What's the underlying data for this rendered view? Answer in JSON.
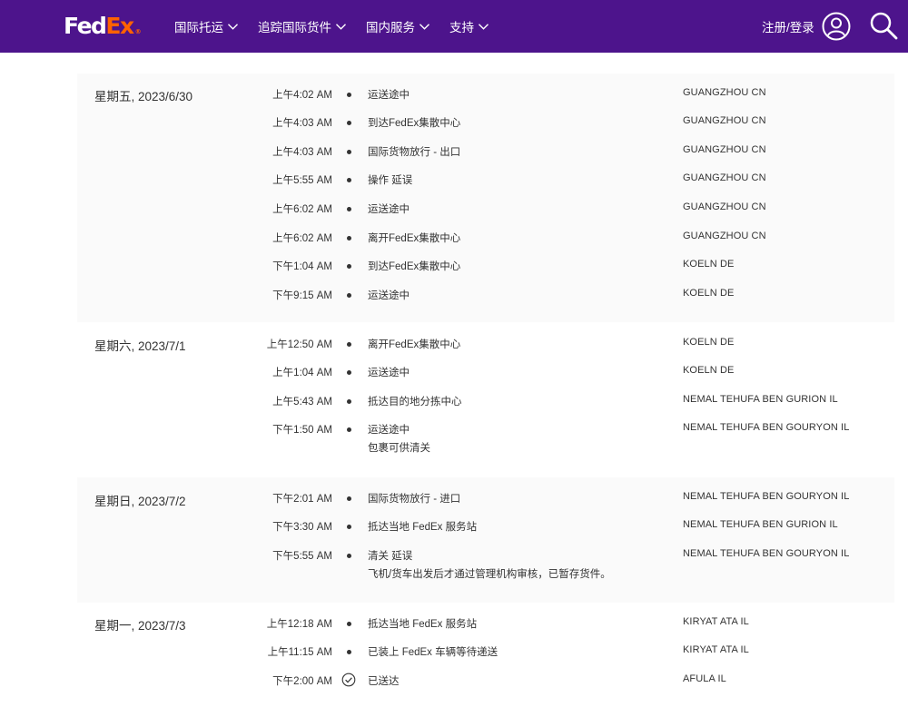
{
  "header": {
    "logo_fed": "Fed",
    "logo_ex": "Ex",
    "logo_reg": "®",
    "nav": [
      "国际托运",
      "追踪国际货件",
      "国内服务",
      "支持"
    ],
    "login_label": "注册/登录",
    "icons": [
      "chevron-down-icon",
      "user-icon",
      "search-icon"
    ],
    "colors": {
      "brand_purple": "#4d148c",
      "brand_orange": "#ff6200"
    }
  },
  "days": [
    {
      "date": "星期五, 2023/6/30",
      "events": [
        {
          "time": "上午4:02 AM",
          "desc": "运送途中",
          "sub": "",
          "loc": "GUANGZHOU CN",
          "icon": "bullet"
        },
        {
          "time": "上午4:03 AM",
          "desc": "到达FedEx集散中心",
          "sub": "",
          "loc": "GUANGZHOU CN",
          "icon": "bullet"
        },
        {
          "time": "上午4:03 AM",
          "desc": "国际货物放行 - 出口",
          "sub": "",
          "loc": "GUANGZHOU CN",
          "icon": "bullet"
        },
        {
          "time": "上午5:55 AM",
          "desc": "操作 延误",
          "sub": "",
          "loc": "GUANGZHOU CN",
          "icon": "bullet"
        },
        {
          "time": "上午6:02 AM",
          "desc": "运送途中",
          "sub": "",
          "loc": "GUANGZHOU CN",
          "icon": "bullet"
        },
        {
          "time": "上午6:02 AM",
          "desc": "离开FedEx集散中心",
          "sub": "",
          "loc": "GUANGZHOU CN",
          "icon": "bullet"
        },
        {
          "time": "下午1:04 AM",
          "desc": "到达FedEx集散中心",
          "sub": "",
          "loc": "KOELN DE",
          "icon": "bullet"
        },
        {
          "time": "下午9:15 AM",
          "desc": "运送途中",
          "sub": "",
          "loc": "KOELN DE",
          "icon": "bullet"
        }
      ]
    },
    {
      "date": "星期六, 2023/7/1",
      "events": [
        {
          "time": "上午12:50 AM",
          "desc": "离开FedEx集散中心",
          "sub": "",
          "loc": "KOELN DE",
          "icon": "bullet"
        },
        {
          "time": "上午1:04 AM",
          "desc": "运送途中",
          "sub": "",
          "loc": "KOELN DE",
          "icon": "bullet"
        },
        {
          "time": "上午5:43 AM",
          "desc": "抵达目的地分拣中心",
          "sub": "",
          "loc": "NEMAL TEHUFA BEN GURION IL",
          "icon": "bullet"
        },
        {
          "time": "下午1:50 AM",
          "desc": "运送途中",
          "sub": "包裹可供清关",
          "loc": "NEMAL TEHUFA BEN GOURYON IL",
          "icon": "bullet"
        }
      ]
    },
    {
      "date": "星期日, 2023/7/2",
      "events": [
        {
          "time": "下午2:01 AM",
          "desc": "国际货物放行 - 进口",
          "sub": "",
          "loc": "NEMAL TEHUFA BEN GOURYON IL",
          "icon": "bullet"
        },
        {
          "time": "下午3:30 AM",
          "desc": "抵达当地 FedEx 服务站",
          "sub": "",
          "loc": "NEMAL TEHUFA BEN GURION IL",
          "icon": "bullet"
        },
        {
          "time": "下午5:55 AM",
          "desc": "清关 延误",
          "sub": "飞机/货车出发后才通过管理机构审核，已暂存货件。",
          "loc": "NEMAL TEHUFA BEN GOURYON IL",
          "icon": "bullet"
        }
      ]
    },
    {
      "date": "星期一, 2023/7/3",
      "events": [
        {
          "time": "上午12:18 AM",
          "desc": "抵达当地 FedEx 服务站",
          "sub": "",
          "loc": "KIRYAT ATA IL",
          "icon": "bullet"
        },
        {
          "time": "上午11:15 AM",
          "desc": "已装上 FedEx 车辆等待递送",
          "sub": "",
          "loc": "KIRYAT ATA IL",
          "icon": "bullet"
        },
        {
          "time": "下午2:00 AM",
          "desc": "已送达",
          "sub": "",
          "loc": "AFULA IL",
          "icon": "check-circle-icon"
        }
      ]
    }
  ]
}
